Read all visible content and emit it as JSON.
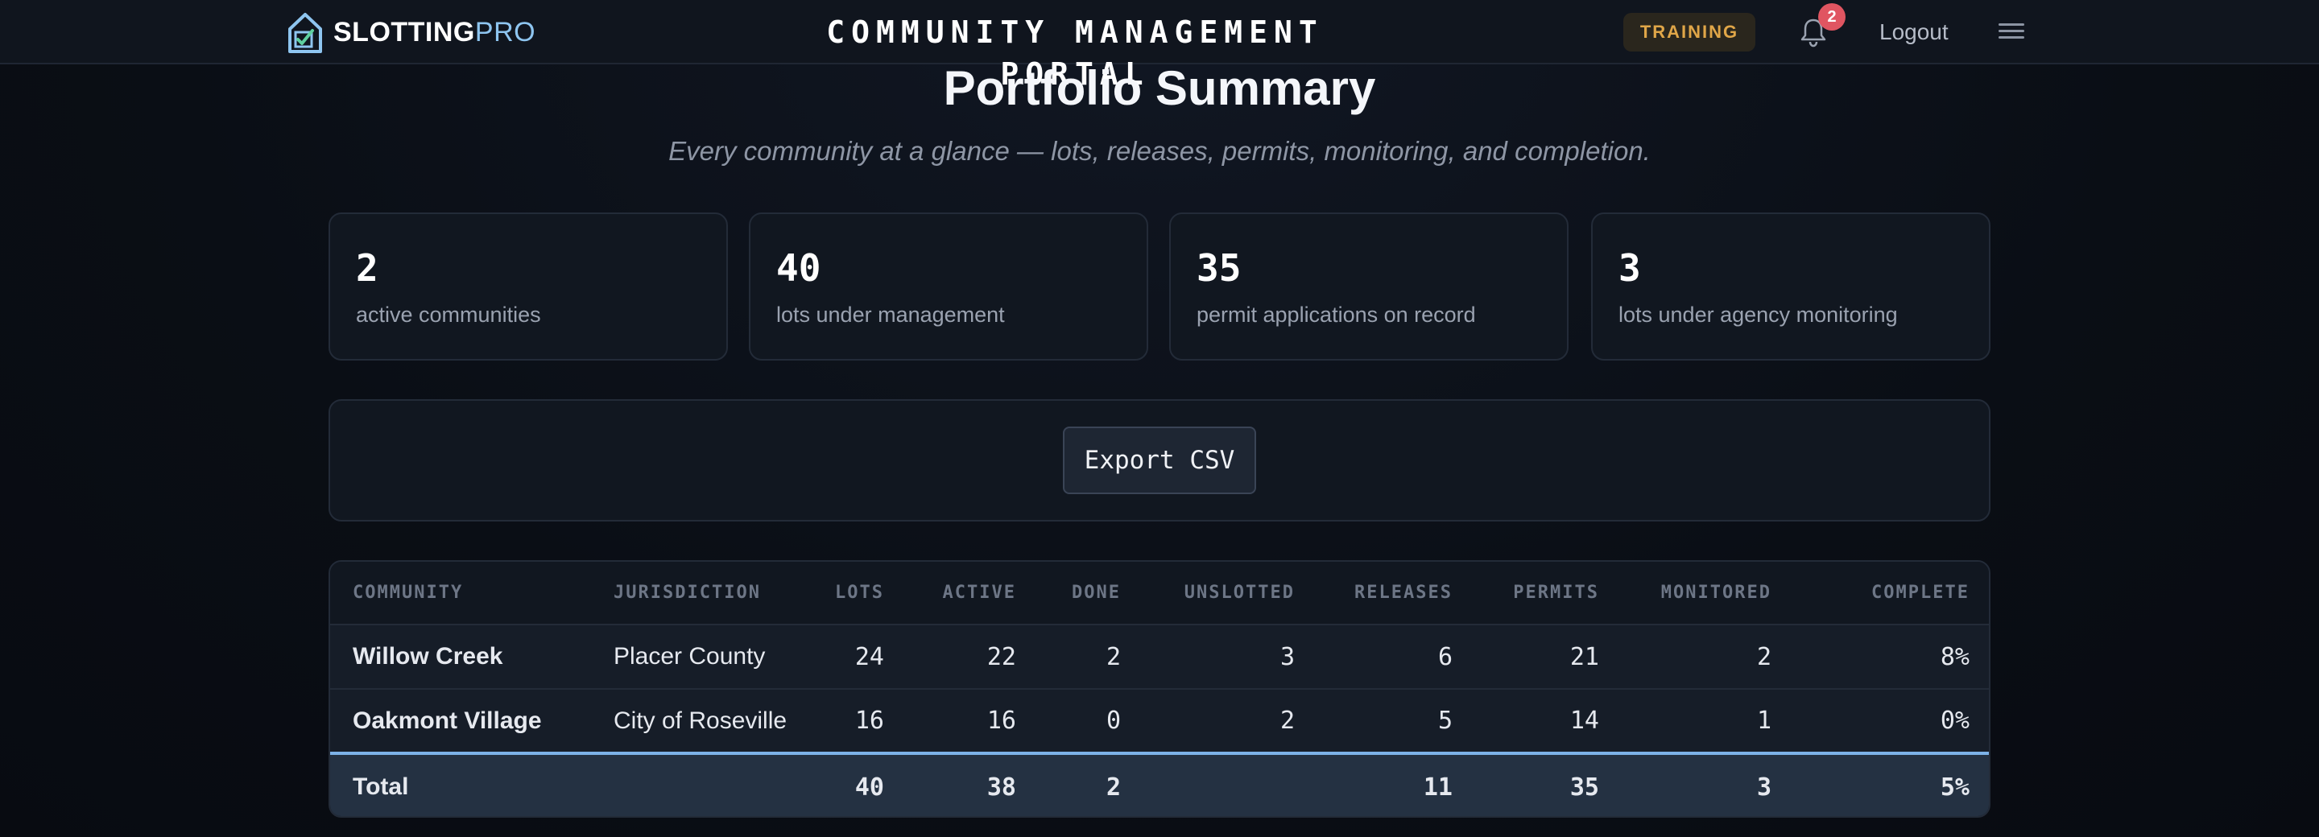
{
  "header": {
    "brand_main": "SLOTTING",
    "brand_pro": "PRO",
    "portal_title": "COMMUNITY MANAGEMENT PORTAL",
    "training_badge": "TRAINING",
    "notification_count": "2",
    "logout_label": "Logout",
    "icons": [
      "house-check-logo-icon",
      "bell-icon",
      "hamburger-menu-icon"
    ]
  },
  "page": {
    "title": "Portfolio Summary",
    "subtitle": "Every community at a glance — lots, releases, permits, monitoring, and completion."
  },
  "stats": [
    {
      "value": "2",
      "label": "active communities"
    },
    {
      "value": "40",
      "label": "lots under management"
    },
    {
      "value": "35",
      "label": "permit applications on record"
    },
    {
      "value": "3",
      "label": "lots under agency monitoring"
    }
  ],
  "export": {
    "label": "Export CSV"
  },
  "table": {
    "columns": [
      "COMMUNITY",
      "JURISDICTION",
      "LOTS",
      "ACTIVE",
      "DONE",
      "UNSLOTTED",
      "RELEASES",
      "PERMITS",
      "MONITORED",
      "COMPLETE"
    ],
    "rows": [
      {
        "community": "Willow Creek",
        "jurisdiction": "Placer County",
        "lots": "24",
        "active": "22",
        "done": "2",
        "unslotted": "3",
        "releases": "6",
        "permits": "21",
        "monitored": "2",
        "complete": "8%"
      },
      {
        "community": "Oakmont Village",
        "jurisdiction": "City of Roseville",
        "lots": "16",
        "active": "16",
        "done": "0",
        "unslotted": "2",
        "releases": "5",
        "permits": "14",
        "monitored": "1",
        "complete": "0%"
      }
    ],
    "total": {
      "label": "Total",
      "jurisdiction": "",
      "lots": "40",
      "active": "38",
      "done": "2",
      "unslotted": "",
      "releases": "11",
      "permits": "35",
      "monitored": "3",
      "complete": "5%"
    }
  },
  "colors": {
    "accent": "#7db2e8",
    "brand_pro": "#8ec5f0",
    "training": "#e0a648",
    "badge": "#e05561"
  }
}
